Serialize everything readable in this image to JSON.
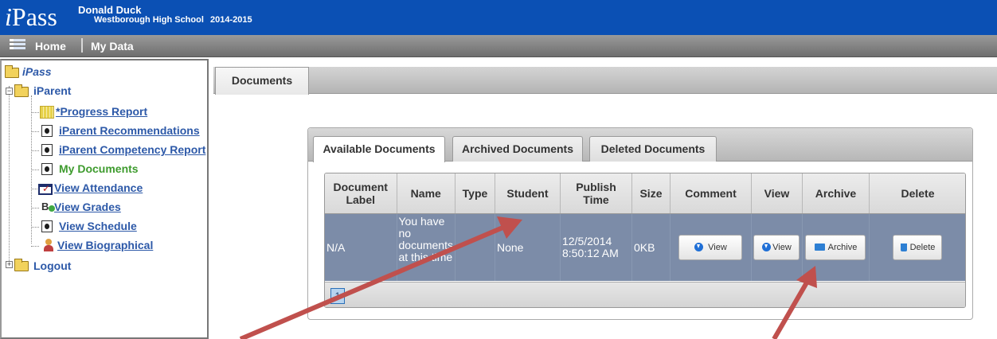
{
  "header": {
    "logo_letter": "i",
    "logo_rest": "Pass",
    "user_name": "Donald Duck",
    "school": "Westborough High School",
    "year": "2014-2015"
  },
  "navbar": {
    "home_label": "Home",
    "mydata_label": "My Data",
    "menu_icon": "hamburger-list-icon"
  },
  "tree": {
    "root": "iPass",
    "iparent": "iParent",
    "items": [
      {
        "label": "*Progress Report",
        "icon": "grid-icon",
        "link": true
      },
      {
        "label": "iParent Recommendations",
        "icon": "document-icon",
        "link": true
      },
      {
        "label": "iParent Competency Report",
        "icon": "document-icon",
        "link": true
      },
      {
        "label": "My Documents",
        "icon": "document-icon",
        "link": false,
        "color": "#3e9b2e"
      },
      {
        "label": "View Attendance",
        "icon": "attendance-icon",
        "link": true
      },
      {
        "label": "View Grades",
        "icon": "grades-icon",
        "link": true
      },
      {
        "label": "View Schedule",
        "icon": "document-icon",
        "link": true
      },
      {
        "label": "View Biographical",
        "icon": "person-icon",
        "link": true
      }
    ],
    "logout": "Logout"
  },
  "main": {
    "tab_label": "Documents",
    "subtabs": [
      "Available Documents",
      "Archived Documents",
      "Deleted Documents"
    ],
    "active_subtab": 0,
    "table": {
      "columns": [
        "Document Label",
        "Name",
        "Type",
        "Student",
        "Publish Time",
        "Size",
        "Comment",
        "View",
        "Archive",
        "Delete"
      ],
      "rows": [
        {
          "label": "N/A",
          "name": "You have no documents at this time",
          "type": "",
          "student": "None",
          "publish_time": "12/5/2014 8:50:12 AM",
          "size": "0KB",
          "comment_btn": "View",
          "view_btn": "View",
          "archive_btn": "Archive",
          "delete_btn": "Delete"
        }
      ]
    },
    "pager": {
      "current_page": "1"
    }
  },
  "colors": {
    "header_blue": "#0b50b4",
    "row_selected": "#7c8ca8",
    "arrow_red": "#c0504d",
    "link_blue": "#2d59a8"
  }
}
